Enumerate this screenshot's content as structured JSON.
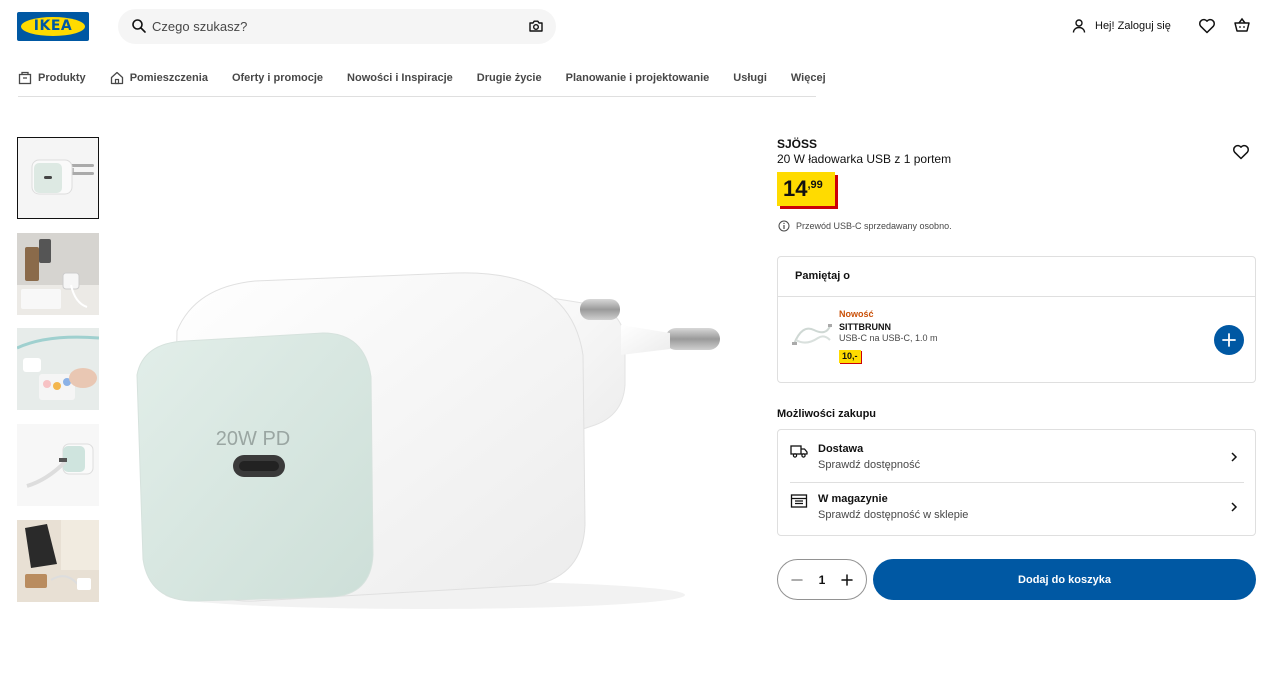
{
  "header": {
    "logo_text": "IKEA",
    "search_placeholder": "Czego szukasz?",
    "login_label": "Hej! Zaloguj się"
  },
  "nav": {
    "items": [
      {
        "label": "Produkty",
        "icon": "box-icon"
      },
      {
        "label": "Pomieszczenia",
        "icon": "house-icon"
      },
      {
        "label": "Oferty i promocje"
      },
      {
        "label": "Nowości i Inspiracje"
      },
      {
        "label": "Drugie życie"
      },
      {
        "label": "Planowanie i projektowanie"
      },
      {
        "label": "Usługi"
      },
      {
        "label": "Więcej"
      }
    ]
  },
  "product": {
    "brand": "SJÖSS",
    "description": "20 W ładowarka USB z 1 portem",
    "price_main": "14",
    "price_decimal": ",99",
    "note": "Przewód USB-C sprzedawany osobno.",
    "image_label": "20W PD"
  },
  "remember": {
    "title": "Pamiętaj o",
    "item": {
      "badge": "Nowość",
      "name": "SITTBRUNN",
      "description": "USB-C na USB-C, 1.0 m",
      "price": "10,-"
    }
  },
  "purchase": {
    "title": "Możliwości zakupu",
    "options": [
      {
        "title": "Dostawa",
        "subtitle": "Sprawdź dostępność",
        "icon": "truck-icon"
      },
      {
        "title": "W magazynie",
        "subtitle": "Sprawdź dostępność w sklepie",
        "icon": "store-icon"
      }
    ]
  },
  "cart": {
    "quantity": "1",
    "add_label": "Dodaj do koszyka"
  },
  "colors": {
    "brand_blue": "#0058a3",
    "brand_yellow": "#ffdb00",
    "price_shadow": "#cc0008",
    "new_badge": "#ca5008"
  }
}
